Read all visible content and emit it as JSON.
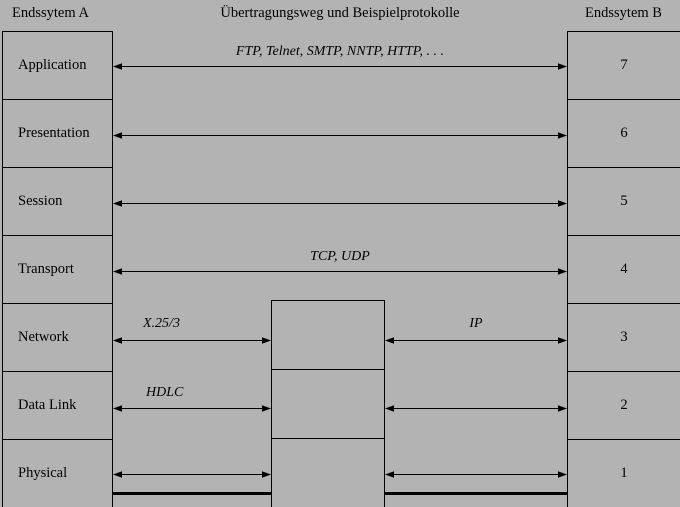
{
  "header": {
    "left": "Endssytem A",
    "middle": "Übertragungsweg und Beispielprotokolle",
    "right": "Endssytem B"
  },
  "layers": {
    "names": [
      "Application",
      "Presentation",
      "Session",
      "Transport",
      "Network",
      "Data Link",
      "Physical"
    ],
    "numbers": [
      "7",
      "6",
      "5",
      "4",
      "3",
      "2",
      "1"
    ]
  },
  "protocols": {
    "application": "FTP,  Telnet,  SMTP,  NNTP,  HTTP,  . . .",
    "transport": "TCP,  UDP",
    "network_left": "X.25/3",
    "network_right": "IP",
    "datalink_left": "HDLC"
  },
  "colors": {
    "background": "#b3b3b3",
    "line": "#000000",
    "text": "#000000"
  }
}
